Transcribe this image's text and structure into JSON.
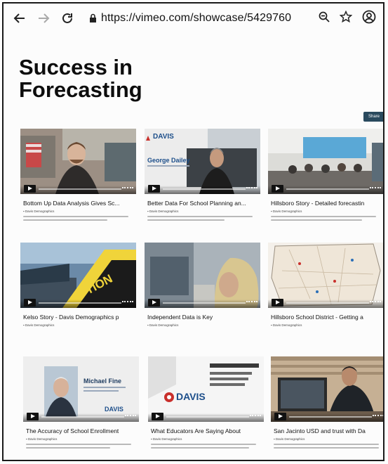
{
  "browser": {
    "url": "https://vimeo.com/showcase/5429760",
    "icons": [
      "back-arrow-icon",
      "forward-arrow-icon",
      "reload-icon",
      "lock-icon",
      "zoom-icon",
      "star-icon",
      "account-icon"
    ]
  },
  "page": {
    "title": "Success in Forecasting",
    "share_label": "Share"
  },
  "videos": [
    {
      "title": "Bottom Up Data Analysis Gives Sc...",
      "byline": "Davis Demographics",
      "progress": 0.0
    },
    {
      "title": "Better Data For School Planning an...",
      "byline": "Davis Demographics",
      "progress": 0.0
    },
    {
      "title": "Hillsboro Story - Detailed forecastin",
      "byline": "Davis Demographics",
      "progress": 0.0
    },
    {
      "title": "Kelso Story - Davis Demographics p",
      "byline": "Davis Demographics",
      "progress": 0.0
    },
    {
      "title": "Independent Data is Key",
      "byline": "Davis Demographics",
      "progress": 0.0
    },
    {
      "title": "Hillsboro School District - Getting a",
      "byline": "Davis Demographics",
      "progress": 0.0
    },
    {
      "title": "The Accuracy of School Enrollment",
      "byline": "Davis Demographics",
      "progress": 0.0
    },
    {
      "title": "What Educators Are Saying About",
      "byline": "Davis Demographics",
      "progress": 0.0
    },
    {
      "title": "San Jacinto USD and trust with Da",
      "byline": "Davis Demographics",
      "progress": 0.0
    }
  ],
  "thumb_text": {
    "davis": "DAVIS",
    "george": "George Dailey",
    "michael": "Michael Fine",
    "action": "TION",
    "davis_educators": "DAVIS"
  },
  "colors": {
    "share_bg": "#2a4a5e",
    "davis_blue": "#1c4e8a",
    "davis_red": "#c9302c"
  }
}
